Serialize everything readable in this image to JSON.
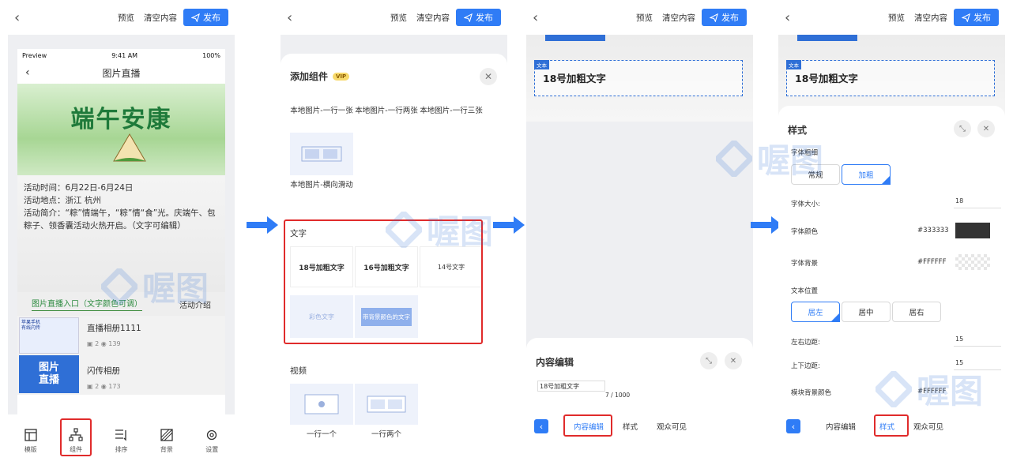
{
  "common": {
    "preview_label": "预览",
    "clear_label": "清空内容",
    "publish_label": "发布",
    "accent_color": "#2f7cf6",
    "highlight_color": "#e02b2b"
  },
  "watermark_text": "喔图",
  "panel1": {
    "status": {
      "carrier": "Preview",
      "time": "9:41 AM",
      "battery": "100%"
    },
    "page_title": "图片直播",
    "banner_text": "端午安康",
    "info_lines": [
      "活动时间：6月22日-6月24日",
      "活动地点：浙江 杭州",
      "活动简介：“粽”情端午，“粽”情“食”光。庆端午、包粽子、领香囊活动火热开启。（文字可编辑）"
    ],
    "entry_link": "图片直播入口（文字颜色可调）",
    "entry_intro": "活动介绍",
    "albums": [
      {
        "title": "直播相册1111",
        "count": "2",
        "views": "139"
      },
      {
        "title": "闪传相册",
        "count": "2",
        "views": "173"
      }
    ],
    "thumb1_lines": [
      "苹果手机",
      "有线闪传"
    ],
    "thumb2_lines": [
      "图片",
      "直播"
    ],
    "nav": [
      {
        "label": "模版",
        "icon": "template-icon"
      },
      {
        "label": "组件",
        "icon": "component-icon"
      },
      {
        "label": "排序",
        "icon": "sort-icon"
      },
      {
        "label": "背景",
        "icon": "background-icon"
      },
      {
        "label": "设置",
        "icon": "gear-icon"
      }
    ]
  },
  "panel2": {
    "sheet_title": "添加组件",
    "vip": "VIP",
    "image_captions": [
      "本地图片-一行一张",
      "本地图片-一行两张",
      "本地图片-一行三张",
      "本地图片-横向滑动"
    ],
    "text_section": "文字",
    "text_cards": [
      "18号加粗文字",
      "16号加粗文字",
      "14号文字",
      "彩色文字",
      "带背景颜色的文字"
    ],
    "video_section": "视频",
    "video_captions": [
      "一行一个",
      "一行两个"
    ]
  },
  "panel3": {
    "text_tag": "文本",
    "text_value": "18号加粗文字",
    "sheet_title": "内容编辑",
    "input_value": "18号加粗文字",
    "counter": "7 / 1000",
    "tabs": [
      "内容编辑",
      "样式",
      "观众可见"
    ]
  },
  "panel4": {
    "text_tag": "文本",
    "text_value": "18号加粗文字",
    "sheet_title": "样式",
    "font_weight_label": "字体粗细",
    "weight_options": [
      "常规",
      "加粗"
    ],
    "font_size_label": "字体大小:",
    "font_size_value": "18",
    "font_color_label": "字体颜色",
    "font_color_value": "#333333",
    "font_bg_label": "字体背景",
    "font_bg_value": "#FFFFFF",
    "align_label": "文本位置",
    "align_options": [
      "居左",
      "居中",
      "居右"
    ],
    "lr_margin_label": "左右边距:",
    "lr_margin_value": "15",
    "tb_margin_label": "上下边距:",
    "tb_margin_value": "15",
    "module_bg_label": "模块背景颜色",
    "module_bg_value": "#FFFFFF",
    "tabs": [
      "内容编辑",
      "样式",
      "观众可见"
    ]
  }
}
